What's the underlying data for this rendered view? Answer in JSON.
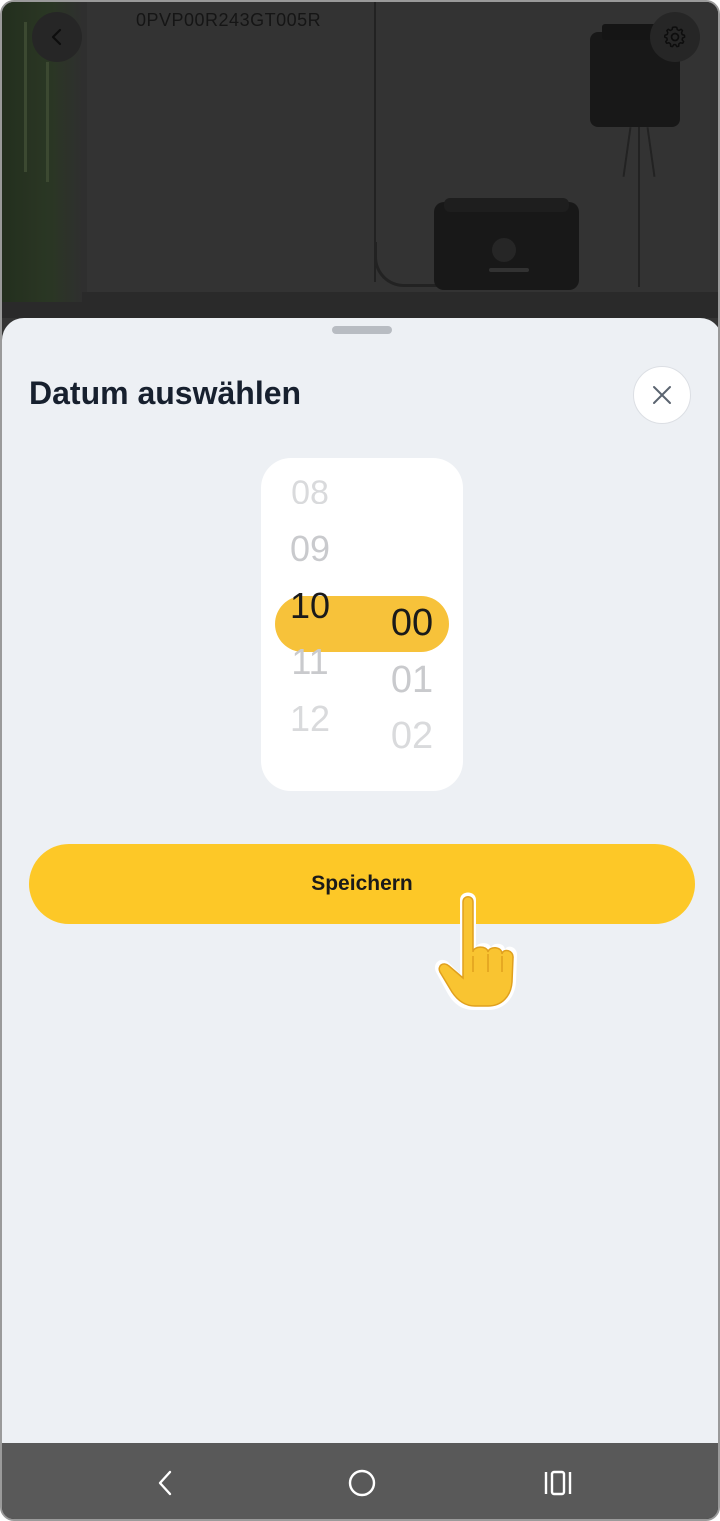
{
  "header": {
    "serial_number": "0PVP00R243GT005R",
    "back_icon": "chevron-left-icon",
    "settings_icon": "gear-icon"
  },
  "sheet": {
    "title": "Datum auswählen",
    "close_icon": "close-icon",
    "picker": {
      "hours": [
        "08",
        "09",
        "10",
        "11",
        "12"
      ],
      "selected_hour": "10",
      "minutes": [
        "00",
        "01",
        "02"
      ],
      "selected_minute": "00",
      "highlight_color": "#f7c23a"
    },
    "save_label": "Speichern",
    "accent_color": "#fdc827"
  },
  "overlay": {
    "pointer_icon": "pointing-hand-icon"
  },
  "navbar": {
    "back_icon": "nav-back-icon",
    "home_icon": "nav-home-icon",
    "recents_icon": "nav-recents-icon"
  }
}
